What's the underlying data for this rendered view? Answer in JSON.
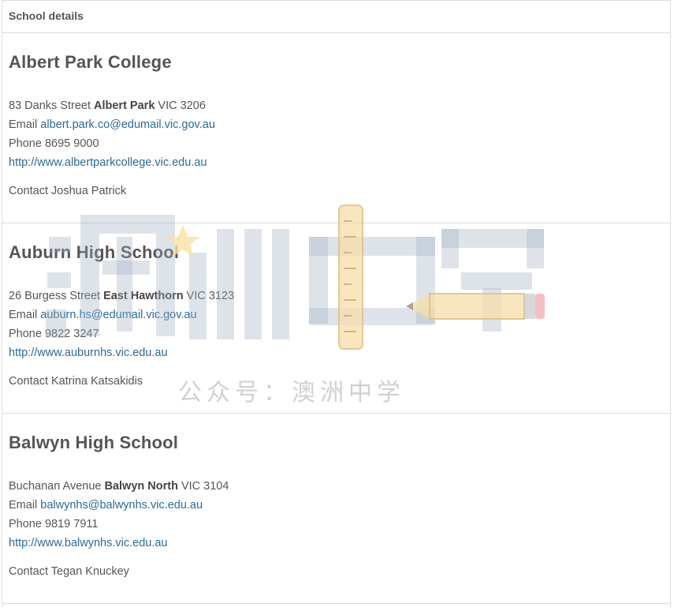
{
  "header": {
    "title": "School details"
  },
  "schools": [
    {
      "name": "Albert Park College",
      "street": "83 Danks Street",
      "suburb": "Albert Park",
      "state_postcode": "VIC 3206",
      "email_label": "Email",
      "email": "albert.park.co@edumail.vic.gov.au",
      "phone_label": "Phone",
      "phone": "8695 9000",
      "website": "http://www.albertparkcollege.vic.edu.au",
      "contact_label": "Contact",
      "contact": "Joshua Patrick"
    },
    {
      "name": "Auburn High School",
      "street": "26 Burgess Street",
      "suburb": "East Hawthorn",
      "state_postcode": "VIC 3123",
      "email_label": "Email",
      "email": "auburn.hs@edumail.vic.gov.au",
      "phone_label": "Phone",
      "phone": "9822 3247",
      "website": "http://www.auburnhs.vic.edu.au",
      "contact_label": "Contact",
      "contact": "Katrina Katsakidis"
    },
    {
      "name": "Balwyn High School",
      "street": "Buchanan Avenue",
      "suburb": "Balwyn North",
      "state_postcode": "VIC 3104",
      "email_label": "Email",
      "email": "balwynhs@balwynhs.vic.edu.au",
      "phone_label": "Phone",
      "phone": "9819 7911",
      "website": "http://www.balwynhs.vic.edu.au",
      "contact_label": "Contact",
      "contact": "Tegan Knuckey"
    }
  ],
  "watermark": {
    "logo_text": "澳洲中学",
    "caption": "公众号：澳洲中学",
    "icon": "pencil-ruler-icon"
  }
}
